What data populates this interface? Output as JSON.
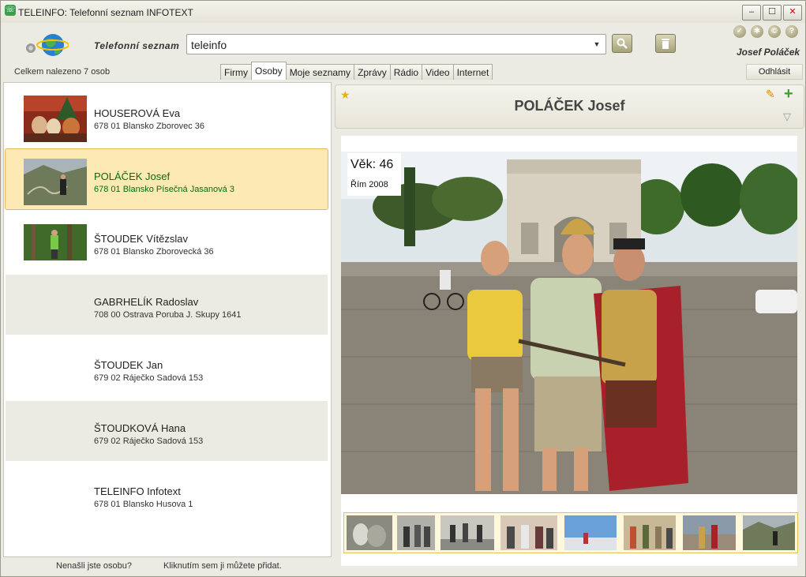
{
  "window": {
    "title": "TELEINFO: Telefonní seznam INFOTEXT"
  },
  "header": {
    "phonebook_label": "Telefonní seznam",
    "search_value": "teleinfo",
    "user_name": "Josef Poláček",
    "logout_label": "Odhlásit",
    "found_count": "Celkem nalezeno 7 osob"
  },
  "tabs": [
    {
      "label": "Firmy"
    },
    {
      "label": "Osoby",
      "active": true
    },
    {
      "label": "Moje seznamy"
    },
    {
      "label": "Zprávy"
    },
    {
      "label": "Rádio"
    },
    {
      "label": "Video"
    },
    {
      "label": "Internet"
    }
  ],
  "people": [
    {
      "name": "HOUSEROVÁ Eva",
      "address": "678 01  Blansko Zborovec 36"
    },
    {
      "name": "POLÁČEK Josef",
      "address": "678 01  Blansko Písečná Jasanová 3"
    },
    {
      "name": "ŠTOUDEK Vítězslav",
      "address": "678 01  Blansko Zborovecká 36"
    },
    {
      "name": "GABRHELÍK Radoslav",
      "address": "708 00  Ostrava Poruba J. Skupy 1641"
    },
    {
      "name": "ŠTOUDEK Jan",
      "address": "679 02  Ráječko Sadová 153"
    },
    {
      "name": "ŠTOUDKOVÁ Hana",
      "address": "679 02  Ráječko Sadová 153"
    },
    {
      "name": "TELEINFO Infotext",
      "address": "678 01  Blansko  Husova 1"
    }
  ],
  "footer": {
    "not_found": "Nenašli jste osobu?",
    "add_hint": "Kliknutím sem ji můžete přidat."
  },
  "detail": {
    "name": "POLÁČEK Josef",
    "age_text": "Věk:  46",
    "photo_caption": "Řím 2008"
  },
  "colors": {
    "selected_bg": "#fde9b3",
    "selected_text": "#0a6d0a",
    "accent": "#a8a27a"
  }
}
